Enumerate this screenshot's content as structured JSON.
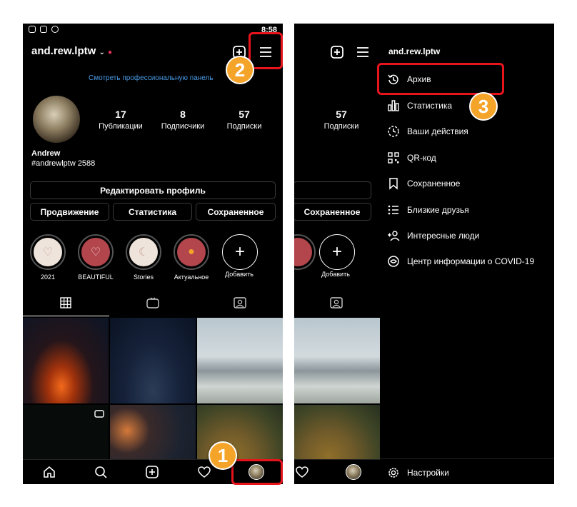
{
  "status": {
    "time": "8:58"
  },
  "profile": {
    "username": "and.rew.lptw",
    "pro_panel_link": "Смотреть профессиональную панель",
    "name": "Andrew",
    "bio": "#andrewlptw 2588",
    "stats": [
      {
        "value": "17",
        "label": "Публикации"
      },
      {
        "value": "8",
        "label": "Подписчики"
      },
      {
        "value": "57",
        "label": "Подписки"
      }
    ],
    "edit_button": "Редактировать профиль",
    "buttons": [
      "Продвижение",
      "Статистика",
      "Сохраненное"
    ],
    "highlights": [
      "2021",
      "BEAUTIFUL",
      "Stories",
      "Актуальное",
      "Добавить"
    ]
  },
  "menu": {
    "username": "and.rew.lptw",
    "items": [
      {
        "label": "Архив",
        "icon": "archive-icon"
      },
      {
        "label": "Статистика",
        "icon": "stats-icon"
      },
      {
        "label": "Ваши действия",
        "icon": "activity-icon"
      },
      {
        "label": "QR-код",
        "icon": "qr-icon"
      },
      {
        "label": "Сохраненное",
        "icon": "bookmark-icon"
      },
      {
        "label": "Близкие друзья",
        "icon": "close-friends-icon"
      },
      {
        "label": "Интересные люди",
        "icon": "discover-people-icon"
      },
      {
        "label": "Центр информации о COVID-19",
        "icon": "covid-info-icon"
      }
    ],
    "settings": "Настройки"
  },
  "badges": [
    "1",
    "2",
    "3"
  ],
  "colors": {
    "accent": "#e8141c",
    "badge": "#f5a42a",
    "link": "#4a9ce8",
    "background": "#000000"
  }
}
